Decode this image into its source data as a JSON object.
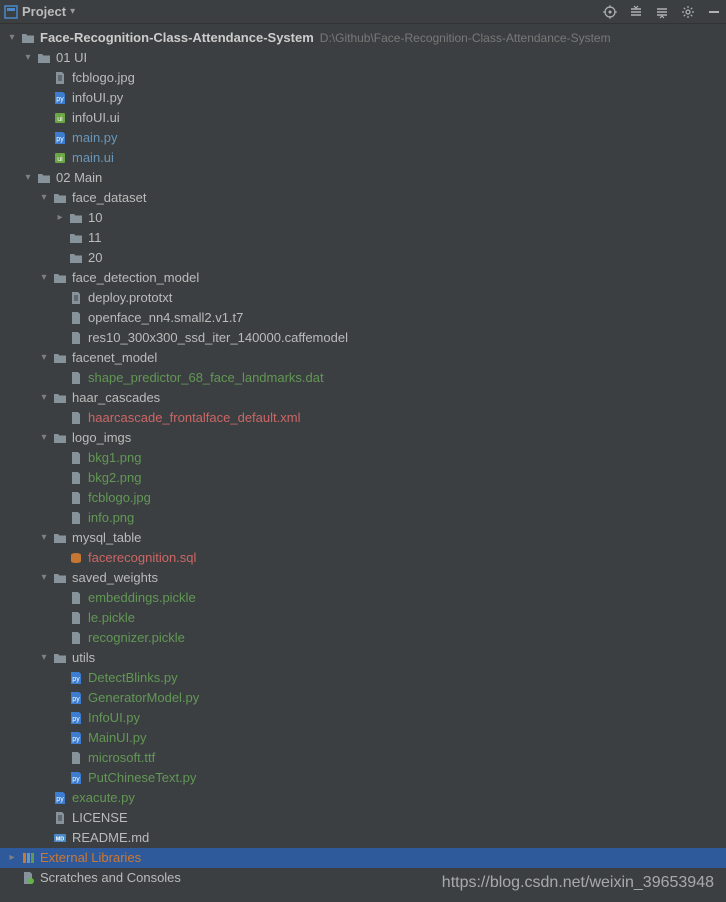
{
  "toolbar": {
    "project_label": "Project"
  },
  "tree": [
    {
      "depth": 0,
      "chevron": "expanded",
      "icon": "folder",
      "label": "Face-Recognition-Class-Attendance-System",
      "bold": true,
      "color": "",
      "path": "D:\\Github\\Face-Recognition-Class-Attendance-System"
    },
    {
      "depth": 1,
      "chevron": "expanded",
      "icon": "folder",
      "label": "01 UI",
      "color": ""
    },
    {
      "depth": 2,
      "chevron": "none",
      "icon": "txt",
      "label": "fcblogo.jpg",
      "color": ""
    },
    {
      "depth": 2,
      "chevron": "none",
      "icon": "py",
      "label": "infoUI.py",
      "color": ""
    },
    {
      "depth": 2,
      "chevron": "none",
      "icon": "ui",
      "label": "infoUI.ui",
      "color": ""
    },
    {
      "depth": 2,
      "chevron": "none",
      "icon": "py",
      "label": "main.py",
      "color": "modified"
    },
    {
      "depth": 2,
      "chevron": "none",
      "icon": "ui",
      "label": "main.ui",
      "color": "modified"
    },
    {
      "depth": 1,
      "chevron": "expanded",
      "icon": "folder",
      "label": "02 Main",
      "color": ""
    },
    {
      "depth": 2,
      "chevron": "expanded",
      "icon": "folder",
      "label": "face_dataset",
      "color": ""
    },
    {
      "depth": 3,
      "chevron": "collapsed",
      "icon": "folder",
      "label": "10",
      "color": ""
    },
    {
      "depth": 3,
      "chevron": "none",
      "icon": "folder",
      "label": "11",
      "color": ""
    },
    {
      "depth": 3,
      "chevron": "none",
      "icon": "folder",
      "label": "20",
      "color": ""
    },
    {
      "depth": 2,
      "chevron": "expanded",
      "icon": "folder",
      "label": "face_detection_model",
      "color": ""
    },
    {
      "depth": 3,
      "chevron": "none",
      "icon": "txt",
      "label": "deploy.prototxt",
      "color": ""
    },
    {
      "depth": 3,
      "chevron": "none",
      "icon": "generic",
      "label": "openface_nn4.small2.v1.t7",
      "color": ""
    },
    {
      "depth": 3,
      "chevron": "none",
      "icon": "generic",
      "label": "res10_300x300_ssd_iter_140000.caffemodel",
      "color": ""
    },
    {
      "depth": 2,
      "chevron": "expanded",
      "icon": "folder",
      "label": "facenet_model",
      "color": ""
    },
    {
      "depth": 3,
      "chevron": "none",
      "icon": "generic",
      "label": "shape_predictor_68_face_landmarks.dat",
      "color": "vcs-green"
    },
    {
      "depth": 2,
      "chevron": "expanded",
      "icon": "folder",
      "label": "haar_cascades",
      "color": ""
    },
    {
      "depth": 3,
      "chevron": "none",
      "icon": "generic",
      "label": "haarcascade_frontalface_default.xml",
      "color": "vcs-red"
    },
    {
      "depth": 2,
      "chevron": "expanded",
      "icon": "folder",
      "label": "logo_imgs",
      "color": ""
    },
    {
      "depth": 3,
      "chevron": "none",
      "icon": "generic",
      "label": "bkg1.png",
      "color": "vcs-green"
    },
    {
      "depth": 3,
      "chevron": "none",
      "icon": "generic",
      "label": "bkg2.png",
      "color": "vcs-green"
    },
    {
      "depth": 3,
      "chevron": "none",
      "icon": "generic",
      "label": "fcblogo.jpg",
      "color": "vcs-green"
    },
    {
      "depth": 3,
      "chevron": "none",
      "icon": "generic",
      "label": "info.png",
      "color": "vcs-green"
    },
    {
      "depth": 2,
      "chevron": "expanded",
      "icon": "folder",
      "label": "mysql_table",
      "color": ""
    },
    {
      "depth": 3,
      "chevron": "none",
      "icon": "sql",
      "label": "facerecognition.sql",
      "color": "vcs-red"
    },
    {
      "depth": 2,
      "chevron": "expanded",
      "icon": "folder",
      "label": "saved_weights",
      "color": ""
    },
    {
      "depth": 3,
      "chevron": "none",
      "icon": "generic",
      "label": "embeddings.pickle",
      "color": "vcs-green"
    },
    {
      "depth": 3,
      "chevron": "none",
      "icon": "generic",
      "label": "le.pickle",
      "color": "vcs-green"
    },
    {
      "depth": 3,
      "chevron": "none",
      "icon": "generic",
      "label": "recognizer.pickle",
      "color": "vcs-green"
    },
    {
      "depth": 2,
      "chevron": "expanded",
      "icon": "folder",
      "label": "utils",
      "color": ""
    },
    {
      "depth": 3,
      "chevron": "none",
      "icon": "py",
      "label": "DetectBlinks.py",
      "color": "vcs-green"
    },
    {
      "depth": 3,
      "chevron": "none",
      "icon": "py",
      "label": "GeneratorModel.py",
      "color": "vcs-green"
    },
    {
      "depth": 3,
      "chevron": "none",
      "icon": "py",
      "label": "InfoUI.py",
      "color": "vcs-green"
    },
    {
      "depth": 3,
      "chevron": "none",
      "icon": "py",
      "label": "MainUI.py",
      "color": "vcs-green"
    },
    {
      "depth": 3,
      "chevron": "none",
      "icon": "generic",
      "label": "microsoft.ttf",
      "color": "vcs-green"
    },
    {
      "depth": 3,
      "chevron": "none",
      "icon": "py",
      "label": "PutChineseText.py",
      "color": "vcs-green"
    },
    {
      "depth": 2,
      "chevron": "none",
      "icon": "py",
      "label": "exacute.py",
      "color": "vcs-green"
    },
    {
      "depth": 2,
      "chevron": "none",
      "icon": "txt",
      "label": "LICENSE",
      "color": ""
    },
    {
      "depth": 2,
      "chevron": "none",
      "icon": "md",
      "label": "README.md",
      "color": ""
    },
    {
      "depth": 0,
      "chevron": "collapsed",
      "icon": "lib",
      "label": "External Libraries",
      "color": "lib",
      "selected": true
    },
    {
      "depth": 0,
      "chevron": "none",
      "icon": "scratch",
      "label": "Scratches and Consoles",
      "color": ""
    }
  ],
  "watermark": "https://blog.csdn.net/weixin_39653948"
}
